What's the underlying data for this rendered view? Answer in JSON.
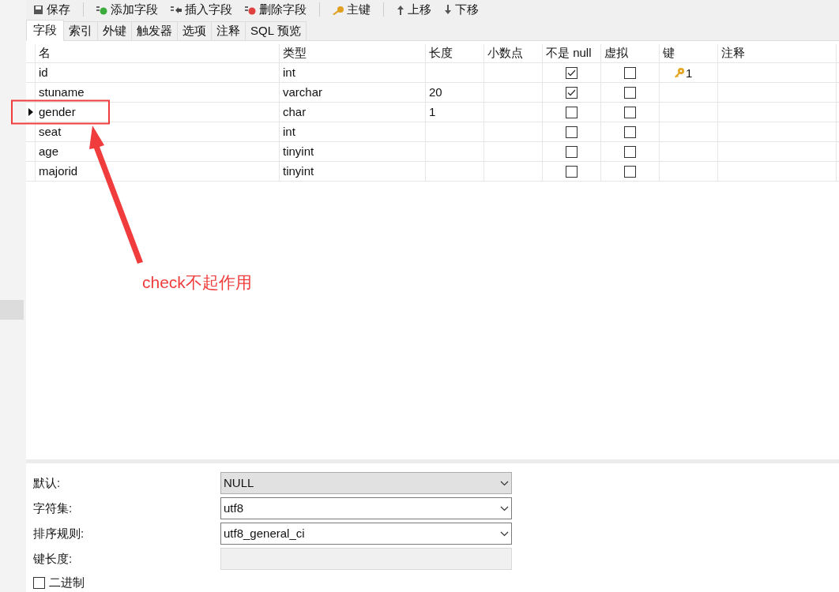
{
  "toolbar": [
    {
      "kind": "save",
      "label": "保存"
    },
    {
      "kind": "add",
      "label": "添加字段"
    },
    {
      "kind": "insert",
      "label": "插入字段"
    },
    {
      "kind": "delete",
      "label": "删除字段"
    },
    {
      "kind": "key",
      "label": "主键"
    },
    {
      "kind": "up",
      "label": "上移"
    },
    {
      "kind": "down",
      "label": "下移"
    }
  ],
  "tabs": [
    {
      "label": "字段",
      "selected": true
    },
    {
      "label": "索引",
      "selected": false
    },
    {
      "label": "外键",
      "selected": false
    },
    {
      "label": "触发器",
      "selected": false
    },
    {
      "label": "选项",
      "selected": false
    },
    {
      "label": "注释",
      "selected": false
    },
    {
      "label": "SQL 预览",
      "selected": false
    }
  ],
  "table": {
    "columns": [
      "名",
      "类型",
      "长度",
      "小数点",
      "不是 null",
      "虚拟",
      "键",
      "注释"
    ],
    "rows": [
      {
        "name": "id",
        "type": "int",
        "length": "",
        "decimals": "",
        "not_null": true,
        "virtual": false,
        "key": "1",
        "selected": false
      },
      {
        "name": "stuname",
        "type": "varchar",
        "length": "20",
        "decimals": "",
        "not_null": true,
        "virtual": false,
        "key": "",
        "selected": false
      },
      {
        "name": "gender",
        "type": "char",
        "length": "1",
        "decimals": "",
        "not_null": false,
        "virtual": false,
        "key": "",
        "selected": true
      },
      {
        "name": "seat",
        "type": "int",
        "length": "",
        "decimals": "",
        "not_null": false,
        "virtual": false,
        "key": "",
        "selected": false
      },
      {
        "name": "age",
        "type": "tinyint",
        "length": "",
        "decimals": "",
        "not_null": false,
        "virtual": false,
        "key": "",
        "selected": false
      },
      {
        "name": "majorid",
        "type": "tinyint",
        "length": "",
        "decimals": "",
        "not_null": false,
        "virtual": false,
        "key": "",
        "selected": false
      }
    ]
  },
  "properties": [
    {
      "label": "默认:",
      "value": "NULL",
      "kind": "combo-gray"
    },
    {
      "label": "字符集:",
      "value": "utf8",
      "kind": "combo"
    },
    {
      "label": "排序规则:",
      "value": "utf8_general_ci",
      "kind": "combo"
    },
    {
      "label": "键长度:",
      "kind": "disabled"
    }
  ],
  "binary": {
    "label": "二进制",
    "checked": false
  },
  "annotation": {
    "text": "check不起作用"
  }
}
